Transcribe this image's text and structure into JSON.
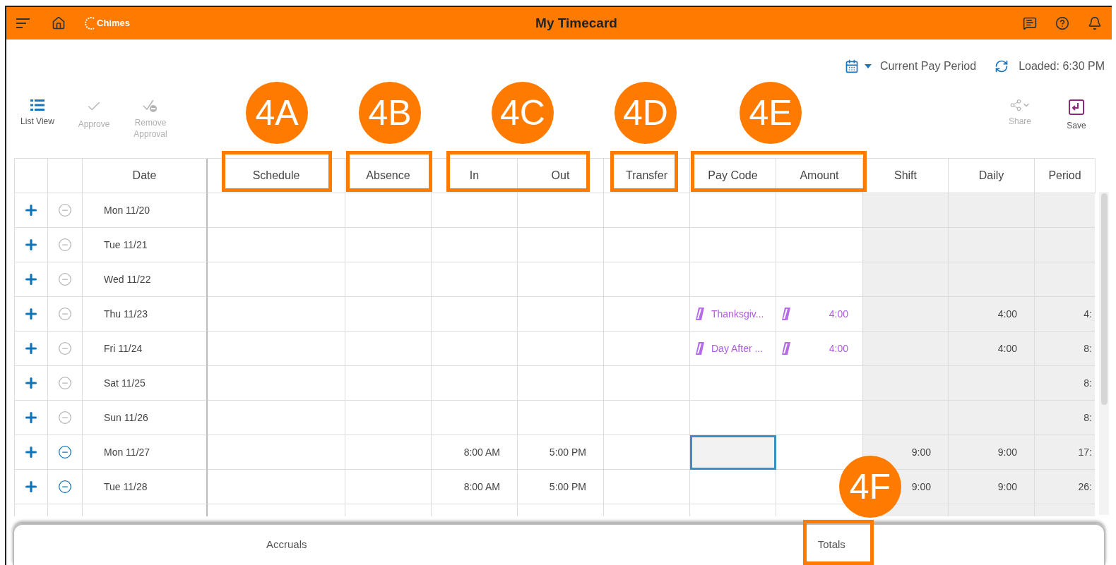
{
  "header": {
    "logo": "Chimes",
    "title": "My Timecard"
  },
  "period": {
    "label": "Current Pay Period",
    "loaded": "Loaded: 6:30 PM"
  },
  "toolbar_left": [
    {
      "kind": "list",
      "label": "List View",
      "disabled": false
    },
    {
      "kind": "approve",
      "label": "Approve",
      "disabled": true
    },
    {
      "kind": "remove",
      "label": "Remove Approval",
      "disabled": true
    }
  ],
  "toolbar_right": [
    {
      "kind": "share",
      "label": "Share",
      "disabled": true
    },
    {
      "kind": "save",
      "label": "Save",
      "disabled": false
    }
  ],
  "table": {
    "columns": [
      "Date",
      "Schedule",
      "Absence",
      "In",
      "Out",
      "Transfer",
      "Pay Code",
      "Amount",
      "Shift",
      "Daily",
      "Period"
    ],
    "rows": [
      {
        "date": "Mon 11/20",
        "removable": false,
        "pay_code": "",
        "amount": "",
        "in": "",
        "out": "",
        "shift": "",
        "daily": "",
        "period": "",
        "focused": false
      },
      {
        "date": "Tue 11/21",
        "removable": false,
        "pay_code": "",
        "amount": "",
        "in": "",
        "out": "",
        "shift": "",
        "daily": "",
        "period": "",
        "focused": false
      },
      {
        "date": "Wed 11/22",
        "removable": false,
        "pay_code": "",
        "amount": "",
        "in": "",
        "out": "",
        "shift": "",
        "daily": "",
        "period": "",
        "focused": false
      },
      {
        "date": "Thu 11/23",
        "removable": false,
        "pay_code": "Thanksgiv...",
        "amount": "4:00",
        "in": "",
        "out": "",
        "shift": "",
        "daily": "4:00",
        "period": "4:",
        "focused": false
      },
      {
        "date": "Fri 11/24",
        "removable": false,
        "pay_code": "Day After ...",
        "amount": "4:00",
        "in": "",
        "out": "",
        "shift": "",
        "daily": "4:00",
        "period": "8:",
        "focused": false
      },
      {
        "date": "Sat 11/25",
        "removable": false,
        "pay_code": "",
        "amount": "",
        "in": "",
        "out": "",
        "shift": "",
        "daily": "",
        "period": "8:",
        "focused": false
      },
      {
        "date": "Sun 11/26",
        "removable": false,
        "pay_code": "",
        "amount": "",
        "in": "",
        "out": "",
        "shift": "",
        "daily": "",
        "period": "8:",
        "focused": false
      },
      {
        "date": "Mon 11/27",
        "removable": true,
        "pay_code": "",
        "amount": "",
        "in": "8:00 AM",
        "out": "5:00 PM",
        "shift": "9:00",
        "daily": "9:00",
        "period": "17:",
        "focused": true
      },
      {
        "date": "Tue 11/28",
        "removable": true,
        "pay_code": "",
        "amount": "",
        "in": "8:00 AM",
        "out": "5:00 PM",
        "shift": "9:00",
        "daily": "9:00",
        "period": "26:",
        "focused": false
      }
    ]
  },
  "bottom_tabs": [
    {
      "label": "Accruals",
      "selected": false
    },
    {
      "label": "Totals",
      "selected": false
    }
  ],
  "callouts": [
    {
      "label": "4A"
    },
    {
      "label": "4B"
    },
    {
      "label": "4C"
    },
    {
      "label": "4D"
    },
    {
      "label": "4E"
    },
    {
      "label": "4F"
    }
  ]
}
